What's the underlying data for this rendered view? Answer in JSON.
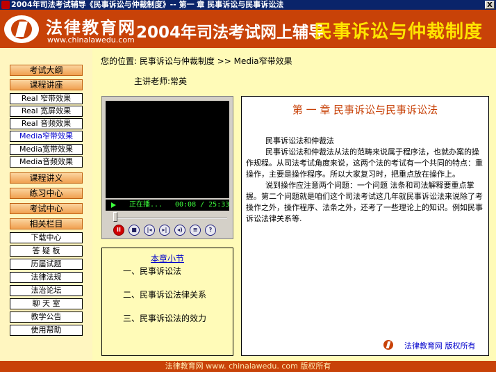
{
  "window": {
    "title": "2004年司法考试辅导《民事诉讼与仲裁制度》-- 第一 章   民事诉讼与民事诉讼法",
    "close_label": "X"
  },
  "header": {
    "brand_name": "法律教育网",
    "brand_url": "www.chinalawedu.com",
    "title": "2004年司法考试网上辅导",
    "subject": "民事诉讼与仲裁制度"
  },
  "sidebar": {
    "items": [
      {
        "label": "考试大纲"
      },
      {
        "label": "课程讲座"
      },
      {
        "label": "Real 窄带效果"
      },
      {
        "label": "Real 宽屏效果"
      },
      {
        "label": "Real 音频效果"
      },
      {
        "label": "Media窄带效果"
      },
      {
        "label": "Media宽带效果"
      },
      {
        "label": "Media音频效果"
      },
      {
        "label": "课程讲义"
      },
      {
        "label": "练习中心"
      },
      {
        "label": "考试中心"
      },
      {
        "label": "相关栏目"
      },
      {
        "label": "下载中心"
      },
      {
        "label": "答 疑 板"
      },
      {
        "label": "历届试题"
      },
      {
        "label": "法律法规"
      },
      {
        "label": "法治论坛"
      },
      {
        "label": "聊 天 室"
      },
      {
        "label": "教学公告"
      },
      {
        "label": "使用帮助"
      }
    ]
  },
  "breadcrumb": "您的位置: 民事诉讼与仲裁制度 >> Media窄带效果",
  "teacher": "主讲老师:常英",
  "player": {
    "status": "正在播...",
    "time": "00:08 / 25:33",
    "progress": 0.005,
    "controls": [
      "pause",
      "stop",
      "previous",
      "next",
      "volume",
      "playlist",
      "help"
    ]
  },
  "chapter_list": {
    "heading": "本章小节",
    "items": [
      "一、民事诉讼法",
      "二、民事诉讼法律关系",
      "三、民事诉讼法的效力"
    ]
  },
  "content": {
    "chapter_title": "第 一 章   民事诉讼与民事诉讼法",
    "paragraphs": [
      "民事诉讼法和仲裁法",
      "民事诉讼法和仲裁法从法的范畴来说属于程序法，也就办案的操作规程。从司法考试角度来说，这两个法的考试有一个共同的特点：重操作，主要是操作程序。所以大家复习时，把重点放在操作上。",
      "说到操作应注意两个问题：一个问题 法条和司法解释要重点掌握。第二个问题就是咱们这个司法考试这几年就民事诉讼法来说除了考操作之外，操作程序、法条之外，还考了一些理论上的知识。例如民事诉讼法律关系等."
    ],
    "footer_link": "法律教育网   版权所有"
  },
  "bottom_bar": "法律教育网 www. chinalawedu. com   版权所有"
}
